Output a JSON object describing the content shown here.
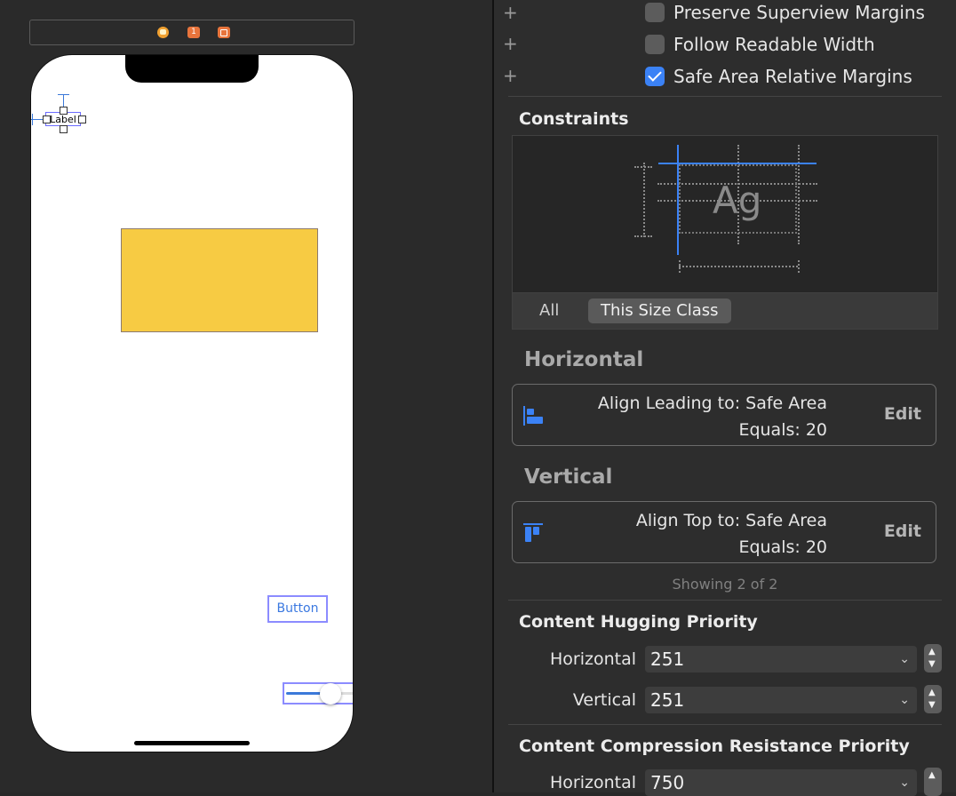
{
  "scene_bar": {
    "icons": [
      "view-controller-icon",
      "first-responder-icon",
      "exit-icon"
    ],
    "first_responder_glyph": "1"
  },
  "canvas": {
    "label_text": "Label",
    "button_label": "Button",
    "yellow_color": "#f7cb43",
    "slider_value": 0.5
  },
  "inspector": {
    "checks": [
      {
        "label": "Preserve Superview Margins",
        "checked": false
      },
      {
        "label": "Follow Readable Width",
        "checked": false
      },
      {
        "label": "Safe Area Relative Margins",
        "checked": true
      }
    ],
    "constraints_title": "Constraints",
    "preview_text": "Ag",
    "size_tabs": {
      "all": "All",
      "this_size_class": "This Size Class"
    },
    "horizontal_title": "Horizontal",
    "horizontal": {
      "line1": "Align Leading to:  Safe Area",
      "line2": "Equals:  20",
      "edit": "Edit"
    },
    "vertical_title": "Vertical",
    "vertical": {
      "line1": "Align Top to:  Safe Area",
      "line2": "Equals:  20",
      "edit": "Edit"
    },
    "showing": "Showing 2 of 2",
    "hugging_title": "Content Hugging Priority",
    "hugging": {
      "horizontal_label": "Horizontal",
      "horizontal_value": "251",
      "vertical_label": "Vertical",
      "vertical_value": "251"
    },
    "compression_title": "Content Compression Resistance Priority",
    "compression": {
      "horizontal_label": "Horizontal",
      "horizontal_value": "750"
    },
    "accent_color": "#3b82f6"
  }
}
